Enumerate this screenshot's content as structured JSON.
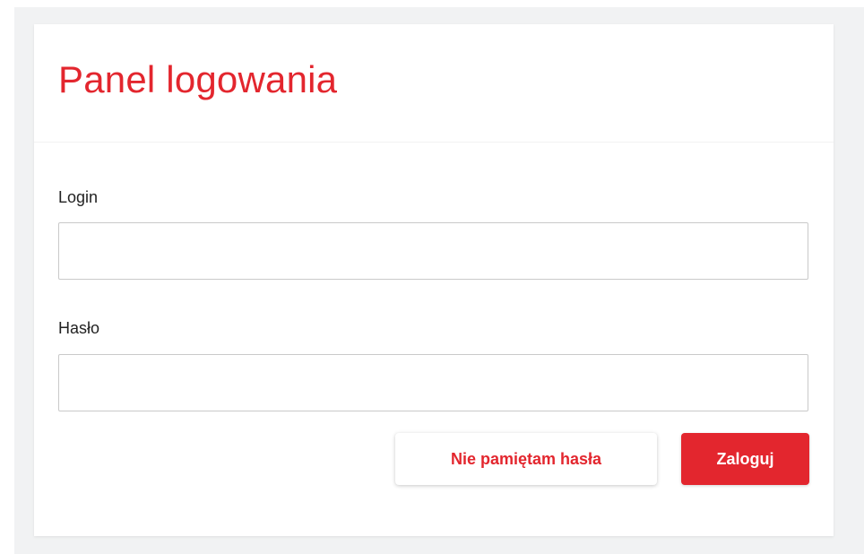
{
  "login_panel": {
    "title": "Panel logowania",
    "login_label": "Login",
    "login_value": "",
    "password_label": "Hasło",
    "password_value": "",
    "forgot_password_button": "Nie pamiętam hasła",
    "submit_button": "Zaloguj"
  },
  "colors": {
    "accent": "#e3262e",
    "page_background": "#f1f2f3",
    "card_background": "#ffffff",
    "text": "#222222"
  }
}
